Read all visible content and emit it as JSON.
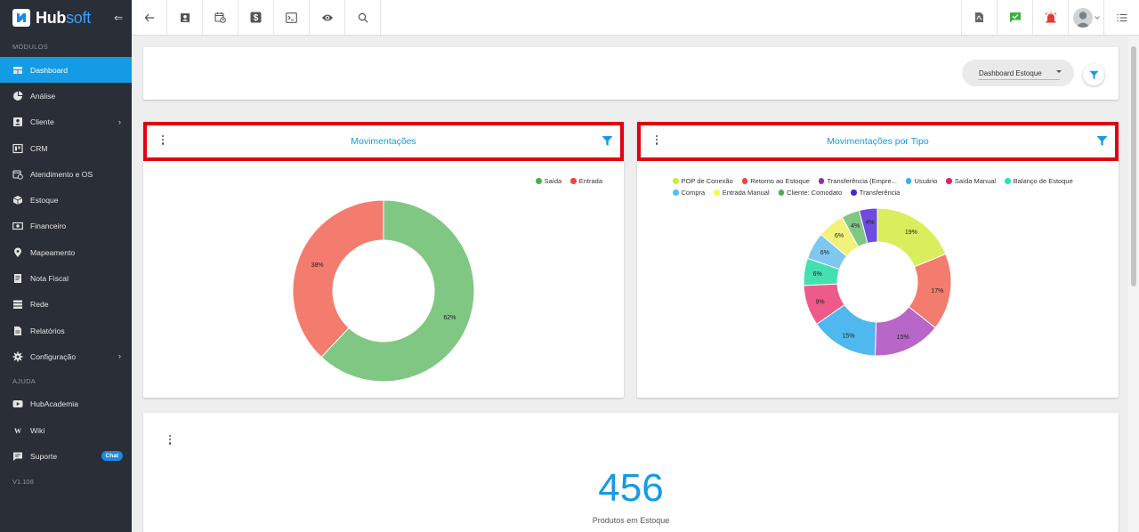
{
  "brand": {
    "name_a": "Hub",
    "name_b": "soft",
    "collapse_glyph": "⇐"
  },
  "sidebar": {
    "modules_label": "MÓDULOS",
    "items": [
      {
        "label": "Dashboard",
        "icon": "dashboard-icon",
        "active": true
      },
      {
        "label": "Análise",
        "icon": "pie-chart-icon"
      },
      {
        "label": "Cliente",
        "icon": "contact-card-icon",
        "chevron": true
      },
      {
        "label": "CRM",
        "icon": "crm-board-icon"
      },
      {
        "label": "Atendimento e OS",
        "icon": "calendar-clock-icon"
      },
      {
        "label": "Estoque",
        "icon": "box-icon"
      },
      {
        "label": "Financeiro",
        "icon": "money-icon"
      },
      {
        "label": "Mapeamento",
        "icon": "map-pin-icon"
      },
      {
        "label": "Nota Fiscal",
        "icon": "invoice-icon"
      },
      {
        "label": "Rede",
        "icon": "network-icon"
      },
      {
        "label": "Relatórios",
        "icon": "report-icon"
      },
      {
        "label": "Configuração",
        "icon": "gear-icon",
        "chevron": true
      }
    ],
    "help_label": "AJUDA",
    "help_items": [
      {
        "label": "HubAcademia",
        "icon": "play-icon"
      },
      {
        "label": "Wiki",
        "icon": "wiki-icon"
      },
      {
        "label": "Suporte",
        "icon": "chat-icon",
        "badge": "Chat"
      }
    ],
    "version": "V1.108"
  },
  "topbar": {
    "left_icons": [
      "back-arrow-icon",
      "contact-card-icon",
      "calendar-clock-icon",
      "dollar-icon",
      "terminal-icon",
      "eye-icon",
      "search-icon"
    ],
    "right_icons": [
      "pdf-icon",
      "chat-check-icon",
      "alarm-icon"
    ],
    "menu_icon": "list-menu-icon",
    "accent_green": "#3cb043",
    "accent_red": "#e53935"
  },
  "dashboard_select": {
    "value": "Dashboard Estoque"
  },
  "charts": [
    {
      "title": "Movimentações",
      "chart_data": {
        "type": "pie",
        "donut": true,
        "legend_position": "top-right",
        "categories": [
          "Saída",
          "Entrada"
        ],
        "values": [
          62,
          38
        ],
        "labels": [
          "62%",
          "38%"
        ],
        "colors": [
          "#81c784",
          "#f47c6e"
        ],
        "legend_colors": [
          "#4caf50",
          "#f44336"
        ]
      }
    },
    {
      "title": "Movimentações por Tipo",
      "chart_data": {
        "type": "pie",
        "donut": true,
        "legend_position": "top",
        "categories": [
          "POP de Conexão",
          "Retorno ao Estoque",
          "Transferência (Empre...",
          "Usuário",
          "Saída Manual",
          "Balanço de Estoque",
          "Compra",
          "Entrada Manual",
          "Cliente: Comodato",
          "Transferência"
        ],
        "values": [
          19,
          17,
          15,
          15,
          9,
          6,
          6,
          6,
          4,
          4
        ],
        "labels": [
          "19%",
          "17%",
          "15%",
          "15%",
          "9%",
          "6%",
          "6%",
          "6%",
          "4%",
          "4%"
        ],
        "colors": [
          "#d9ee5c",
          "#f47c6e",
          "#b866c8",
          "#4fb8ee",
          "#ee5b8a",
          "#45e0b0",
          "#7ec7f0",
          "#f2f27a",
          "#81c784",
          "#6f4be0"
        ],
        "legend_colors": [
          "#c6ef35",
          "#f44336",
          "#9c27b0",
          "#29b6f6",
          "#e91e63",
          "#1de9b6",
          "#4fc3f7",
          "#eeff41",
          "#4caf50",
          "#3d2bd8"
        ]
      }
    }
  ],
  "kpi": {
    "value": "456",
    "label": "Produtos em Estoque"
  }
}
